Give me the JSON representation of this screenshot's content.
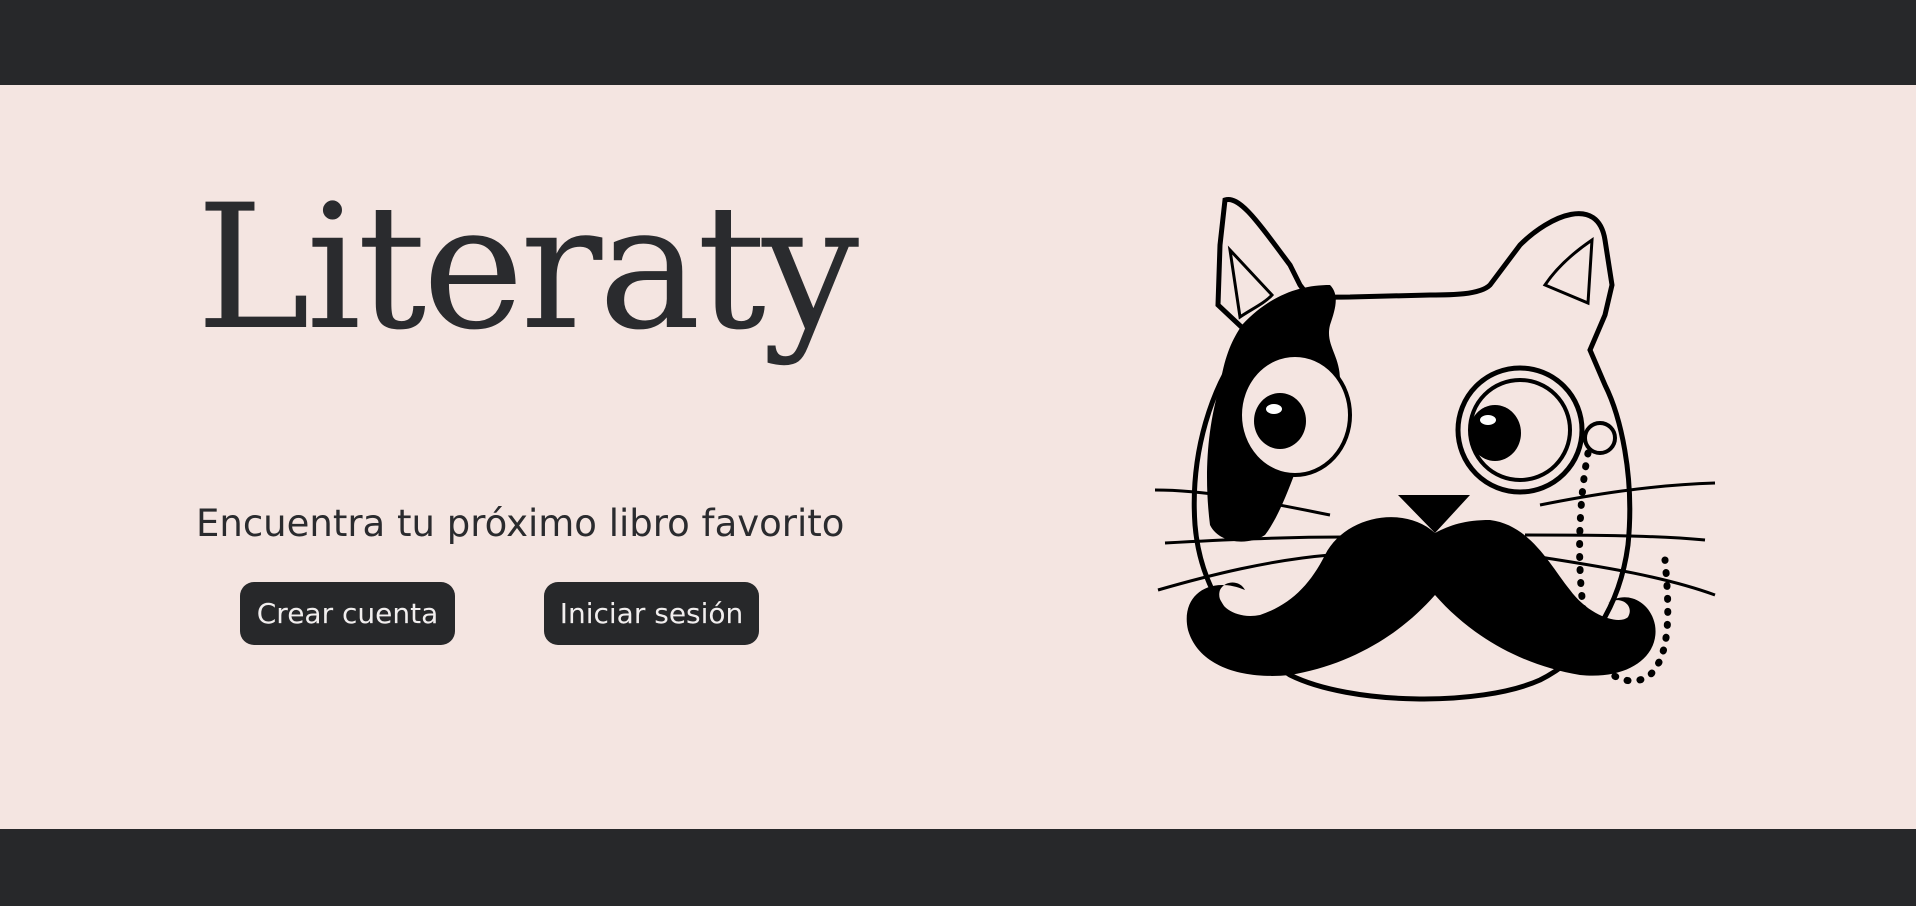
{
  "brand": {
    "name": "Literaty"
  },
  "hero": {
    "tagline": "Encuentra tu próximo libro favorito",
    "actions": {
      "create_account": "Crear cuenta",
      "login": "Iniciar sesión"
    },
    "mascot": "cat-with-monocle-and-mustache"
  },
  "colors": {
    "dark_bar": "#27282a",
    "background": "#f4e5e1",
    "text": "#2a2b2e",
    "button_text": "#f1eeee"
  }
}
